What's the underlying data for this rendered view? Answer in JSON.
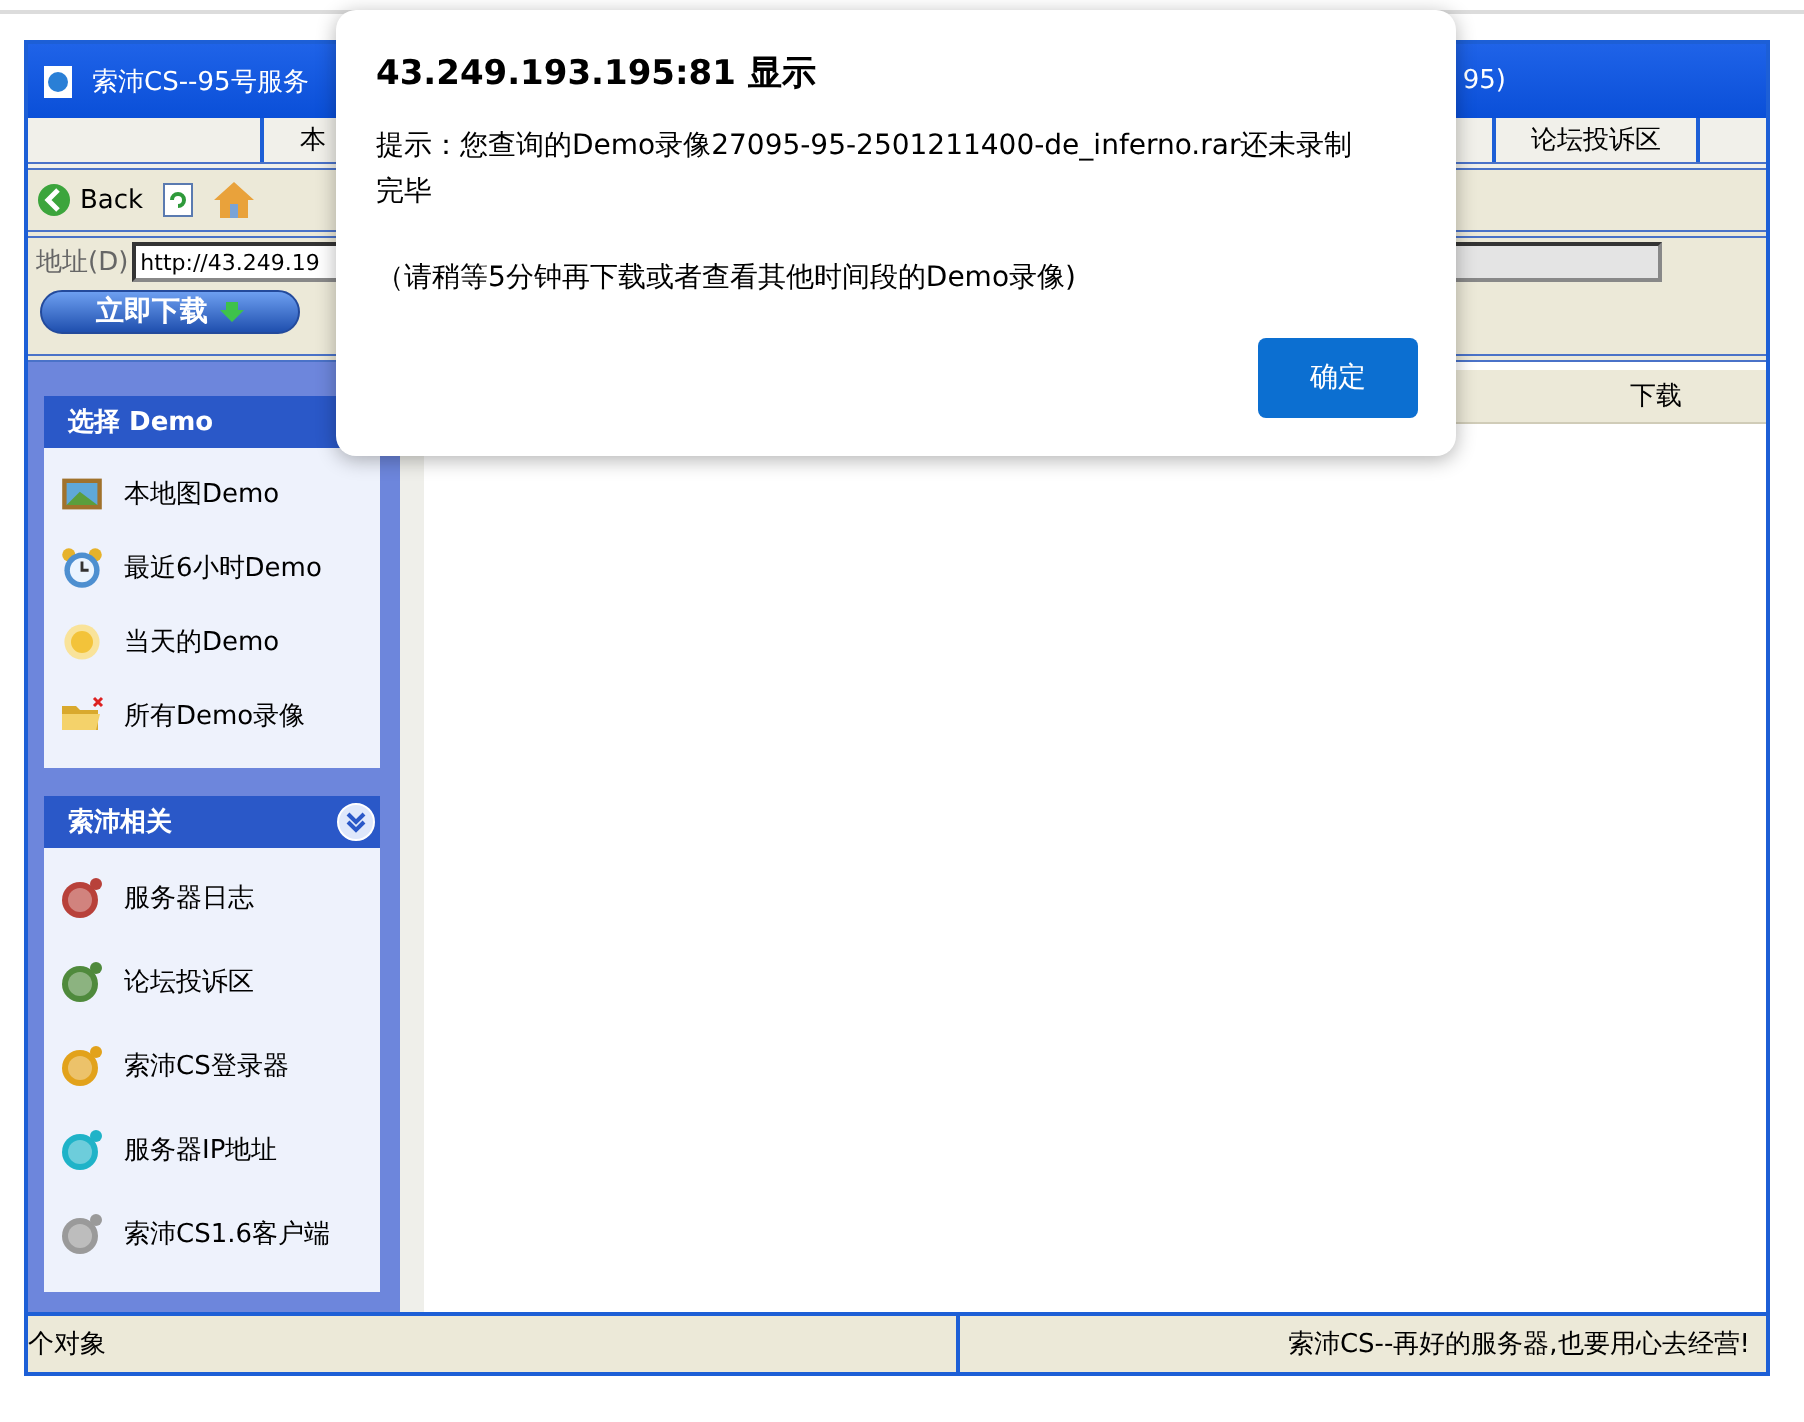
{
  "window": {
    "title_left": "索沛CS--95号服务",
    "title_right": "95)"
  },
  "tabs": [
    {
      "label": "本"
    },
    {
      "label": "论坛投诉区"
    }
  ],
  "toolbar": {
    "back": "Back"
  },
  "address": {
    "label": "地址(D)",
    "value": "http://43.249.19",
    "download": "立即下载"
  },
  "table": {
    "header": "下载"
  },
  "sidebar": [
    {
      "title": "选择 Demo",
      "kind": "plain",
      "items": [
        {
          "label": "本地图Demo",
          "kind": "picture"
        },
        {
          "label": "最近6小时Demo",
          "kind": "clock"
        },
        {
          "label": "当天的Demo",
          "kind": "sun"
        },
        {
          "label": "所有Demo录像",
          "kind": "folder"
        }
      ]
    },
    {
      "title": "索沛相关",
      "kind": "collapsible",
      "items": [
        {
          "label": "服务器日志",
          "kind": "red"
        },
        {
          "label": "论坛投诉区",
          "kind": "green"
        },
        {
          "label": "索沛CS登录器",
          "kind": "orange"
        },
        {
          "label": "服务器IP地址",
          "kind": "cyan"
        },
        {
          "label": "索沛CS1.6客户端",
          "kind": "gray"
        }
      ]
    }
  ],
  "status_bar": {
    "left": "个对象",
    "right": "索沛CS--再好的服务器,也要用心去经营!"
  },
  "dialog": {
    "title": "43.249.193.195:81 显示",
    "message": [
      "提示：您查询的Demo录像27095-95-2501211400-de_inferno.rar还未录制完毕",
      "（请稍等5分钟再下载或者查看其他时间段的Demo录像)"
    ],
    "button": "确定"
  }
}
